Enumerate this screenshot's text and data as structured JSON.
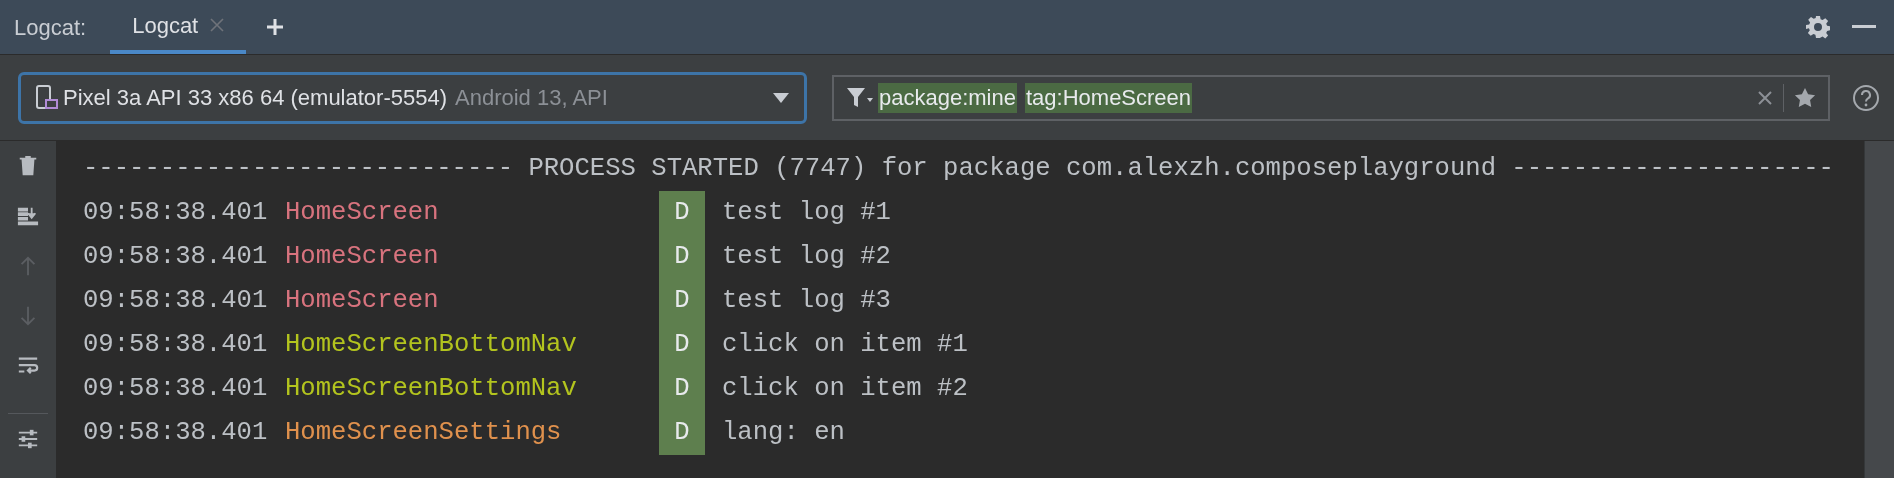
{
  "header": {
    "label": "Logcat:",
    "tabs": [
      {
        "label": "Logcat",
        "selected": true
      }
    ]
  },
  "device_selector": {
    "device": "Pixel 3a API 33 x86 64 (emulator-5554)",
    "detail": "Android 13, API"
  },
  "filter": {
    "tokens": [
      "package:mine",
      "tag:HomeScreen"
    ]
  },
  "toolbar": [
    {
      "kind": "trash",
      "disabled": false
    },
    {
      "kind": "scroll_end",
      "disabled": false
    },
    {
      "kind": "up",
      "disabled": true
    },
    {
      "kind": "down",
      "disabled": true
    },
    {
      "kind": "wrap",
      "disabled": false
    },
    {
      "kind": "settings",
      "disabled": false
    }
  ],
  "log": {
    "process_line": "---------------------------- PROCESS STARTED (7747) for package com.alexzh.composeplayground ---------------------",
    "entries": [
      {
        "time": "09:58:38.401",
        "tag": "HomeScreen",
        "color": "#d8737e",
        "level": "D",
        "message": "test log #1"
      },
      {
        "time": "09:58:38.401",
        "tag": "HomeScreen",
        "color": "#d8737e",
        "level": "D",
        "message": "test log #2"
      },
      {
        "time": "09:58:38.401",
        "tag": "HomeScreen",
        "color": "#d8737e",
        "level": "D",
        "message": "test log #3"
      },
      {
        "time": "09:58:38.401",
        "tag": "HomeScreenBottomNav",
        "color": "#b3c41e",
        "level": "D",
        "message": "click on item #1"
      },
      {
        "time": "09:58:38.401",
        "tag": "HomeScreenBottomNav",
        "color": "#b3c41e",
        "level": "D",
        "message": "click on item #2"
      },
      {
        "time": "09:58:38.401",
        "tag": "HomeScreenSettings",
        "color": "#e0914d",
        "level": "D",
        "message": "lang: en"
      }
    ]
  }
}
